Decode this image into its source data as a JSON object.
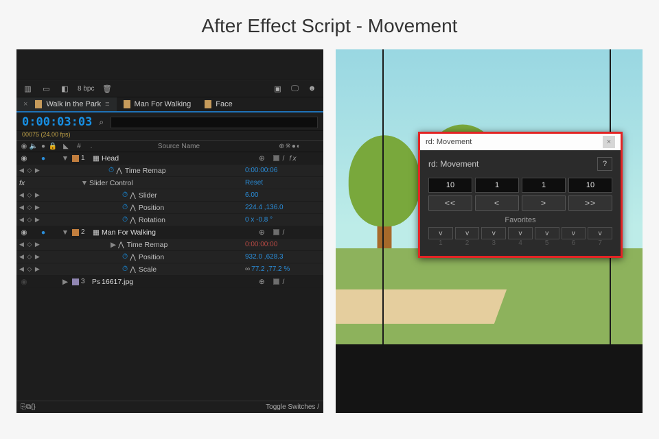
{
  "page_title": "After Effect Script - Movement",
  "toolbar": {
    "bpc": "8 bpc",
    "icons": [
      "composition-mini-flowchart-icon",
      "folder-icon",
      "adjustment-layer-icon",
      "trash-icon"
    ],
    "right_icons": [
      "render-queue-icon",
      "preview-monitor-icon",
      "snapshot-icon"
    ]
  },
  "tabs": [
    {
      "label": "Walk in the Park",
      "active": true
    },
    {
      "label": "Man For Walking",
      "active": false
    },
    {
      "label": "Face",
      "active": false
    }
  ],
  "timeline": {
    "timecode": "0:00:03:03",
    "frame_info": "00075 (24.00 fps)",
    "columns": {
      "hash": "#",
      "source": "Source Name"
    },
    "rows": [
      {
        "kind": "layer",
        "solo_on": true,
        "solo_arrow": "▼",
        "idx": "1",
        "color": "orange",
        "icon": "comp",
        "name": "Head",
        "switches": "fx"
      },
      {
        "kind": "prop",
        "keys": "◀ ◇ ▶",
        "indent": 1,
        "has_clock": true,
        "has_graph": true,
        "name": "Time Remap",
        "value": "0:00:00:06"
      },
      {
        "kind": "group",
        "fx": true,
        "arrow": "▼",
        "indent": 1,
        "name": "Slider Control",
        "value": "Reset"
      },
      {
        "kind": "prop",
        "keys": "◀ ◇ ▶",
        "indent": 2,
        "has_clock": true,
        "has_graph": true,
        "name": "Slider",
        "value": "6.00"
      },
      {
        "kind": "prop",
        "keys": "◀ ◇ ▶",
        "indent": 2,
        "has_clock": true,
        "has_graph": true,
        "name": "Position",
        "value": "224.4 ,136.0"
      },
      {
        "kind": "prop",
        "keys": "◀ ◇ ▶",
        "indent": 2,
        "has_clock": true,
        "has_graph": true,
        "name": "Rotation",
        "value": "0 x -0.8 °"
      },
      {
        "kind": "layer",
        "solo_on": true,
        "solo_arrow": "▼",
        "idx": "2",
        "color": "orange",
        "icon": "comp",
        "name": "Man For Walking",
        "switches": "plain"
      },
      {
        "kind": "prop",
        "keys": "◀ ◇ ▶",
        "arrow": "▶",
        "indent": 1,
        "has_graph": true,
        "name": "Time Remap",
        "value": "0:00:00:00",
        "value_red": true
      },
      {
        "kind": "prop",
        "keys": "◀ ◇ ▶",
        "indent": 2,
        "has_clock": true,
        "has_graph": true,
        "name": "Position",
        "value": "932.0 ,628.3"
      },
      {
        "kind": "prop",
        "keys": "◀ ◇ ▶",
        "indent": 2,
        "has_clock": true,
        "has_graph": true,
        "name": "Scale",
        "value": "77.2 ,77.2 %",
        "linked": true
      },
      {
        "kind": "layer",
        "solo_on": false,
        "solo_arrow": "▶",
        "idx": "3",
        "color": "lav",
        "icon": "photoshop",
        "name": "16617.jpg",
        "switches": "plain"
      }
    ],
    "bottom_left_icons": [
      "toggle-switches-icon",
      "frame-blend-icon",
      "motion-blur-icon"
    ],
    "bottom_right": "Toggle Switches / "
  },
  "rd_dialog": {
    "window_title": "rd: Movement",
    "header": "rd: Movement",
    "help": "?",
    "step_values": [
      "10",
      "1",
      "1",
      "10"
    ],
    "step_buttons": [
      "<<",
      "<",
      ">",
      ">>"
    ],
    "favorites_label": "Favorites",
    "fav_marks": [
      "v",
      "v",
      "v",
      "v",
      "v",
      "v",
      "v"
    ],
    "fav_slots": [
      "1",
      "2",
      "3",
      "4",
      "5",
      "6",
      "7"
    ]
  }
}
